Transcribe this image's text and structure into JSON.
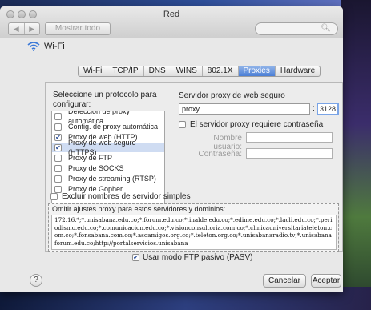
{
  "window": {
    "title": "Red",
    "show_all_label": "Mostrar todo",
    "nav_back": "◀",
    "nav_forward": "▶"
  },
  "header": {
    "interface_name": "Wi-Fi"
  },
  "tabs": [
    {
      "label": "Wi-Fi",
      "active": false
    },
    {
      "label": "TCP/IP",
      "active": false
    },
    {
      "label": "DNS",
      "active": false
    },
    {
      "label": "WINS",
      "active": false
    },
    {
      "label": "802.1X",
      "active": false
    },
    {
      "label": "Proxies",
      "active": true
    },
    {
      "label": "Hardware",
      "active": false
    }
  ],
  "protocols": {
    "title": "Seleccione un protocolo para configurar:",
    "items": [
      {
        "label": "Detección de proxy automática",
        "checked": false,
        "selected": false
      },
      {
        "label": "Config. de proxy automática",
        "checked": false,
        "selected": false
      },
      {
        "label": "Proxy de web (HTTP)",
        "checked": true,
        "selected": false
      },
      {
        "label": "Proxy de web seguro (HTTPS)",
        "checked": true,
        "selected": true
      },
      {
        "label": "Proxy de FTP",
        "checked": false,
        "selected": false
      },
      {
        "label": "Proxy de SOCKS",
        "checked": false,
        "selected": false
      },
      {
        "label": "Proxy de streaming (RTSP)",
        "checked": false,
        "selected": false
      },
      {
        "label": "Proxy de Gopher",
        "checked": false,
        "selected": false
      }
    ]
  },
  "server": {
    "title": "Servidor proxy de web seguro",
    "host": "proxy",
    "port": "3128",
    "requires_password_label": "El servidor proxy requiere contraseña",
    "username_label": "Nombre usuario:",
    "password_label": "Contraseña:"
  },
  "exclude_simple_label": "Excluir nombres de servidor simples",
  "bypass": {
    "label": "Omitir ajustes proxy para estos servidores y dominios:",
    "value": "172.16.*;*.unisabana.edu.co;*.forum.edu.co;*.inalde.edu.co;*.edime.edu.co;*.lacli.edu.co;*.periodismo.edu.co;*.comunicacion.edu.co;*.visionconsultoria.com.co;*.clinicauniversitariateleton.com.co;*.fonsabana.com.co;*.asoamigos.org.co;*.teleton.org.co;*.unisabanaradio.tv;*.unisabanaforum.edu.co;http://portalservicios.unisabana"
  },
  "pasv_label": "Usar modo FTP pasivo (PASV)",
  "buttons": {
    "help": "?",
    "cancel": "Cancelar",
    "ok": "Aceptar"
  }
}
